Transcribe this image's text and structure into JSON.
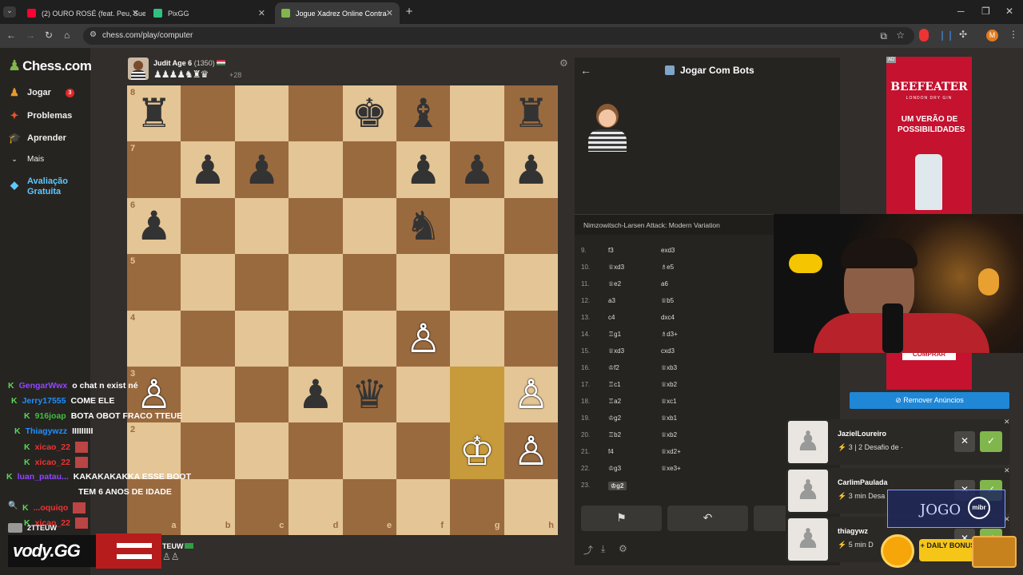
{
  "browser": {
    "tabs": [
      {
        "title": "(2) OURO ROSÉ (feat. Peu, Sueti",
        "fav_color": "#ff0033"
      },
      {
        "title": "PixGG",
        "fav_color": "#2ec27e"
      },
      {
        "title": "Jogue Xadrez Online Contra",
        "fav_color": "#81b64c"
      }
    ],
    "new_tab": "+",
    "url": "chess.com/play/computer"
  },
  "sidebar": {
    "logo": "Chess.com",
    "items": [
      {
        "label": "Jogar",
        "badge": "3"
      },
      {
        "label": "Problemas"
      },
      {
        "label": "Aprender"
      },
      {
        "label": "Mais"
      }
    ],
    "premium_line1": "Avaliação",
    "premium_line2": "Gratuita"
  },
  "opponent": {
    "name": "Judit Age 6",
    "rating": "(1350)",
    "captured": "♟♟♟♟♞♜♛",
    "advantage": "+28"
  },
  "player": {
    "name": "TEUW",
    "captured": "♙♙"
  },
  "board": {
    "files": [
      "a",
      "b",
      "c",
      "d",
      "e",
      "f",
      "g",
      "h"
    ],
    "ranks": [
      "8",
      "7",
      "6",
      "5",
      "4",
      "3",
      "2"
    ],
    "pieces": [
      {
        "sq": "a8",
        "p": "♜",
        "c": "b"
      },
      {
        "sq": "e8",
        "p": "♚",
        "c": "b"
      },
      {
        "sq": "f8",
        "p": "♝",
        "c": "b"
      },
      {
        "sq": "h8",
        "p": "♜",
        "c": "b"
      },
      {
        "sq": "b7",
        "p": "♟",
        "c": "b"
      },
      {
        "sq": "c7",
        "p": "♟",
        "c": "b"
      },
      {
        "sq": "f7",
        "p": "♟",
        "c": "b"
      },
      {
        "sq": "g7",
        "p": "♟",
        "c": "b"
      },
      {
        "sq": "h7",
        "p": "♟",
        "c": "b"
      },
      {
        "sq": "a6",
        "p": "♟",
        "c": "b"
      },
      {
        "sq": "f6",
        "p": "♞",
        "c": "b"
      },
      {
        "sq": "f4",
        "p": "♙",
        "c": "w"
      },
      {
        "sq": "a3",
        "p": "♙",
        "c": "w"
      },
      {
        "sq": "d3",
        "p": "♟",
        "c": "b"
      },
      {
        "sq": "e3",
        "p": "♛",
        "c": "b"
      },
      {
        "sq": "h3",
        "p": "♙",
        "c": "w"
      },
      {
        "sq": "g2",
        "p": "♔",
        "c": "w"
      },
      {
        "sq": "h2",
        "p": "♙",
        "c": "w"
      }
    ],
    "highlight": [
      "g3",
      "g2"
    ]
  },
  "panel": {
    "title": "Jogar Com Bots",
    "opening": "Nimzowitsch-Larsen Attack: Modern Variation",
    "moves": [
      {
        "n": "9.",
        "w": "f3",
        "b": "exd3"
      },
      {
        "n": "10.",
        "w": "♕xd3",
        "b": "♗e5"
      },
      {
        "n": "11.",
        "w": "♕e2",
        "b": "a6"
      },
      {
        "n": "12.",
        "w": "a3",
        "b": "♕b5"
      },
      {
        "n": "13.",
        "w": "c4",
        "b": "dxc4"
      },
      {
        "n": "14.",
        "w": "♖g1",
        "b": "♗d3+"
      },
      {
        "n": "15.",
        "w": "♕xd3",
        "b": "cxd3"
      },
      {
        "n": "16.",
        "w": "♔f2",
        "b": "♕xb3"
      },
      {
        "n": "17.",
        "w": "♖c1",
        "b": "♕xb2"
      },
      {
        "n": "18.",
        "w": "♖a2",
        "b": "♕xc1"
      },
      {
        "n": "19.",
        "w": "♔g2",
        "b": "♕xb1"
      },
      {
        "n": "20.",
        "w": "♖b2",
        "b": "♕xb2"
      },
      {
        "n": "21.",
        "w": "f4",
        "b": "♕xd2+"
      },
      {
        "n": "22.",
        "w": "♔g3",
        "b": "♕xe3+"
      },
      {
        "n": "23.",
        "w": "♔g2",
        "b": ""
      }
    ]
  },
  "ad": {
    "brand": "BEEFEATER",
    "sub": "LONDON DRY GIN",
    "slogan": "UM VERÃO DE POSSIBILIDADES",
    "cta": "COMPRAR",
    "remove": "Remover Anúncios",
    "tag": "AD"
  },
  "challenges": [
    {
      "name": "JazielLoureiro",
      "detail": "3 | 2 Desafio de ·"
    },
    {
      "name": "CarlimPaulada",
      "detail": "3 min Desa"
    },
    {
      "name": "thiagywz",
      "detail": "5 min D"
    }
  ],
  "chat": [
    {
      "user": "GengarWwx",
      "msg": "o chat n exist né",
      "color": "#9146ff"
    },
    {
      "user": "Jerry17555",
      "msg": "COME ELE",
      "color": "#1e90ff"
    },
    {
      "user": "916joap",
      "msg": "BOTA OBOT FRACO TTEUE",
      "color": "#3fbf3f"
    },
    {
      "user": "Thiagywzz",
      "msg": "IIIIIIIII",
      "color": "#1e90ff"
    },
    {
      "user": "xicao_22",
      "msg": "",
      "color": "#e33"
    },
    {
      "user": "xicao_22",
      "msg": "",
      "color": "#e33"
    },
    {
      "user": "luan_patau...",
      "msg": "KAKAKAKAKKA ESSE BOOT",
      "color": "#9146ff"
    },
    {
      "user": "",
      "msg": "TEM 6 ANOS DE IDADE",
      "color": "#fff"
    },
    {
      "user": "...oquiqo",
      "msg": "",
      "color": "#e33"
    },
    {
      "user": "xicao_22",
      "msg": "",
      "color": "#e33"
    }
  ],
  "overlay": {
    "streamer_tag": "2TTEUW",
    "vody": "vody.GG",
    "jogo": "JOGO",
    "mibr": "mibr",
    "daily": "+ DAILY BONUS"
  }
}
